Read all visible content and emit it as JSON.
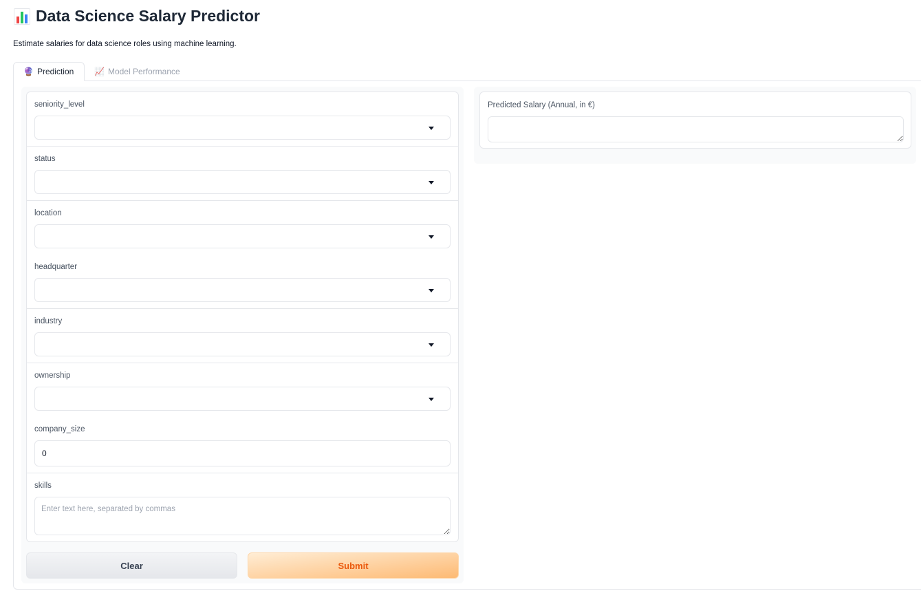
{
  "header": {
    "title": "Data Science Salary Predictor",
    "subtitle": "Estimate salaries for data science roles using machine learning."
  },
  "tabs": [
    {
      "label": "Prediction",
      "icon": "🔮",
      "active": true
    },
    {
      "label": "Model Performance",
      "icon": "📈",
      "active": false
    }
  ],
  "form": {
    "seniority_level": {
      "label": "seniority_level",
      "value": ""
    },
    "status": {
      "label": "status",
      "value": ""
    },
    "location": {
      "label": "location",
      "value": ""
    },
    "headquarter": {
      "label": "headquarter",
      "value": ""
    },
    "industry": {
      "label": "industry",
      "value": ""
    },
    "ownership": {
      "label": "ownership",
      "value": ""
    },
    "company_size": {
      "label": "company_size",
      "value": "0"
    },
    "skills": {
      "label": "skills",
      "value": "",
      "placeholder": "Enter text here, separated by commas"
    }
  },
  "buttons": {
    "clear": "Clear",
    "submit": "Submit"
  },
  "output": {
    "label": "Predicted Salary (Annual, in €)",
    "value": ""
  },
  "colors": {
    "accent": "#ea580c",
    "submit_bg": "#fdba74",
    "border": "#e5e7eb"
  }
}
